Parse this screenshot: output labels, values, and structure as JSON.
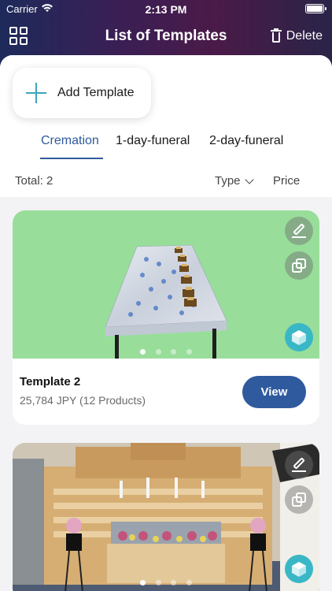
{
  "status_bar": {
    "carrier": "Carrier",
    "time": "2:13 PM"
  },
  "nav": {
    "title": "List of Templates",
    "delete_label": "Delete"
  },
  "add_button_label": "Add Template",
  "tabs": [
    {
      "label": "Cremation",
      "active": true
    },
    {
      "label": "1-day-funeral",
      "active": false
    },
    {
      "label": "2-day-funeral",
      "active": false
    }
  ],
  "list_header": {
    "total": "Total: 2",
    "type_filter": "Type",
    "price_filter": "Price"
  },
  "templates": [
    {
      "title": "Template 2",
      "subtitle": "25,784 JPY (12 Products)",
      "view_label": "View",
      "image_pages": 4,
      "current_page": 1
    },
    {
      "title": "",
      "subtitle": "",
      "view_label": "",
      "image_pages": 4,
      "current_page": 1
    }
  ],
  "colors": {
    "accent": "#2f5a9e",
    "plus": "#3aa6b9",
    "cube": "#3ab7c6",
    "card1_bg": "#98de9a"
  }
}
